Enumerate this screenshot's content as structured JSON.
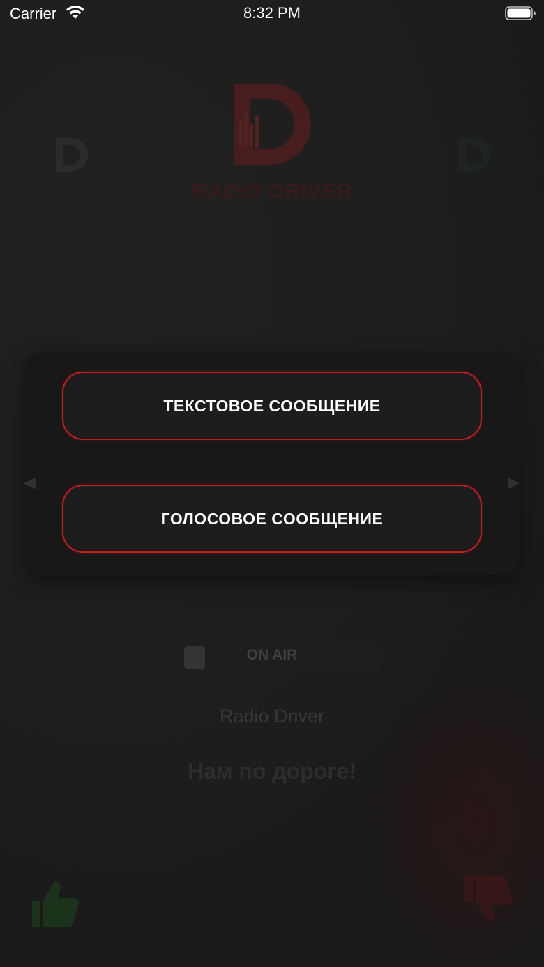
{
  "status_bar": {
    "carrier": "Carrier",
    "time": "8:32 PM",
    "wifi_icon": "wifi-icon",
    "battery_icon": "battery-full-icon"
  },
  "background": {
    "logo_text": "RADIO DRIVER",
    "carousel_title": "",
    "on_air_label": "ON AIR",
    "station_name": "Radio Driver",
    "slogan": "Нам по дороге!",
    "arrow_left": "◀",
    "arrow_right": "▶",
    "like_icon": "thumbs-up-icon",
    "dislike_icon": "thumbs-down-icon"
  },
  "menu": {
    "text_message_label": "ТЕКСТОВОЕ СООБЩЕНИЕ",
    "voice_message_label": "ГОЛОСОВОЕ СООБЩЕНИЕ"
  },
  "colors": {
    "background": "#1e1e1e",
    "button_border": "#c81d1d",
    "button_fill": "#1d1d1d",
    "button_text": "#ffffff",
    "brand_red": "#8a1c1c",
    "like_green": "#1f5a1f"
  }
}
